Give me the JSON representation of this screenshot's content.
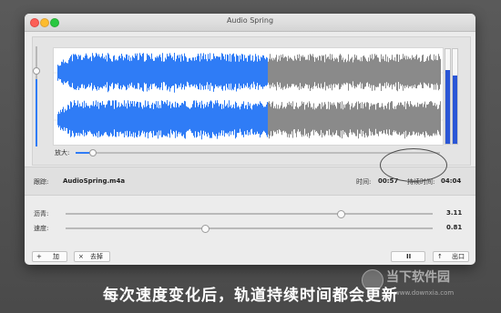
{
  "window": {
    "title": "Audio Spring"
  },
  "waveform": {
    "zoom_label": "放大:",
    "played_color": "#2f7cf6",
    "unplayed_color": "#8a8a8a",
    "played_fraction": 0.55,
    "zoom_level": 0.05,
    "vertical_zoom_level": 0.68,
    "meter_left_level": 0.78,
    "meter_right_level": 0.72
  },
  "info": {
    "track_label": "跟踪:",
    "track_name": "AudioSpring.m4a",
    "time_label": "时间:",
    "time_value": "00:57",
    "duration_label": "持续时间:",
    "duration_value": "04:04"
  },
  "sliders": [
    {
      "label": "沥青:",
      "value": "3.11",
      "position": 0.75
    },
    {
      "label": "速度:",
      "value": "0.81",
      "position": 0.38
    }
  ],
  "buttons": {
    "add_label": "加",
    "remove_label": "去掉",
    "pause_glyph": "II",
    "export_label": "出口"
  },
  "caption": "每次速度变化后，轨道持续时间都会更新",
  "watermark": {
    "brand": "当下软件园",
    "url": "www.downxia.com"
  }
}
